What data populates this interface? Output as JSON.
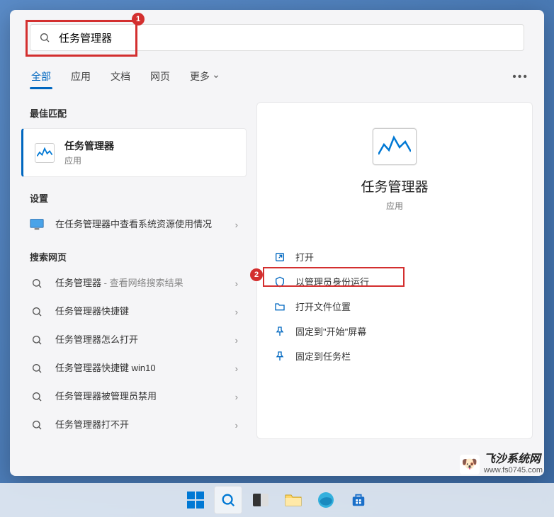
{
  "search": {
    "query": "任务管理器"
  },
  "tabs": [
    "全部",
    "应用",
    "文档",
    "网页",
    "更多"
  ],
  "sections": {
    "bestMatch": "最佳匹配",
    "settings": "设置",
    "searchWeb": "搜索网页"
  },
  "bestMatchItem": {
    "title": "任务管理器",
    "subtitle": "应用"
  },
  "settingsItem": {
    "text": "在任务管理器中查看系统资源使用情况"
  },
  "webResults": [
    {
      "main": "任务管理器",
      "suffix": " - 查看网络搜索结果"
    },
    {
      "main": "任务管理器快捷键",
      "suffix": ""
    },
    {
      "main": "任务管理器怎么打开",
      "suffix": ""
    },
    {
      "main": "任务管理器快捷键 win10",
      "suffix": ""
    },
    {
      "main": "任务管理器被管理员禁用",
      "suffix": ""
    },
    {
      "main": "任务管理器打不开",
      "suffix": ""
    }
  ],
  "preview": {
    "title": "任务管理器",
    "subtitle": "应用",
    "actions": [
      {
        "icon": "open",
        "label": "打开"
      },
      {
        "icon": "shield",
        "label": "以管理员身份运行"
      },
      {
        "icon": "folder",
        "label": "打开文件位置"
      },
      {
        "icon": "pin",
        "label": "固定到\"开始\"屏幕"
      },
      {
        "icon": "pin",
        "label": "固定到任务栏"
      }
    ]
  },
  "annotations": {
    "n1": "1",
    "n2": "2"
  },
  "watermark": {
    "emoji": "🐶",
    "title": "飞沙系统网",
    "url": "www.fs0745.com"
  }
}
